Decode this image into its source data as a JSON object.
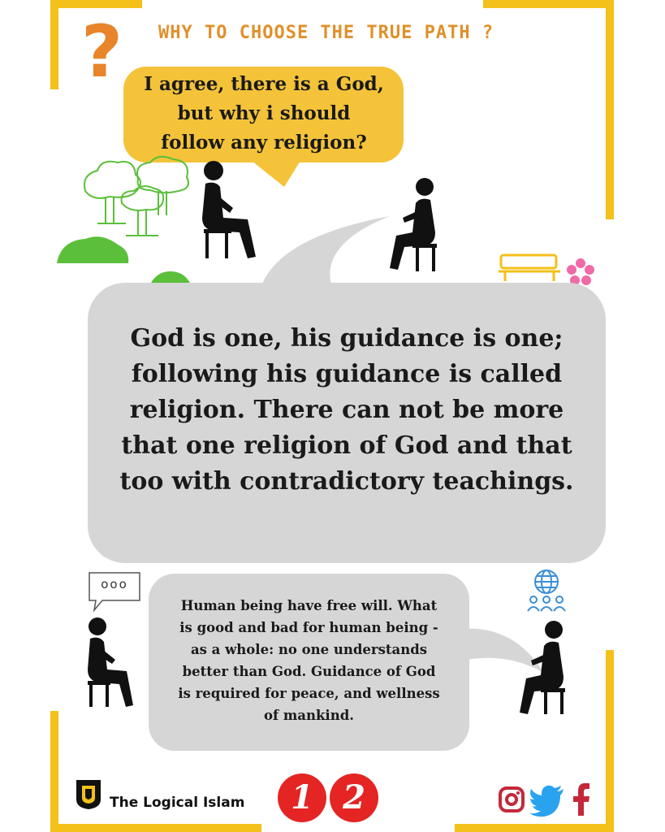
{
  "header": {
    "title": "WHY TO CHOOSE THE TRUE PATH ?",
    "question_mark": "?"
  },
  "speech": {
    "question": [
      "I agree, there is a God,",
      "but why i should",
      "follow any religion?"
    ],
    "answer": [
      "God is one, his guidance is one;",
      "following his guidance is called",
      "religion. There can not be more",
      "that one religion of God and that",
      "too with contradictory teachings."
    ],
    "followup": [
      "Human being have free will. What",
      "is good and bad for human being -",
      "as a whole: no one understands",
      "better than God. Guidance of God",
      "is required for peace,  and wellness",
      "of mankind."
    ]
  },
  "thought_bubble": {
    "text": "ooo"
  },
  "footer": {
    "brand": "The Logical Islam",
    "page_digits": [
      "1",
      "2"
    ],
    "social_icons": [
      "instagram-icon",
      "twitter-icon",
      "facebook-icon"
    ]
  },
  "colors": {
    "frame_yellow": "#f4c01a",
    "bubble_yellow": "#f4c339",
    "bubble_gray": "#d6d6d6",
    "title_orange": "#e0902a",
    "number_red": "#e42523",
    "social_red": "#c4283a",
    "social_blue": "#2aa3ef",
    "globe_blue": "#3a8fd6",
    "tree_green": "#5bbf3a"
  }
}
